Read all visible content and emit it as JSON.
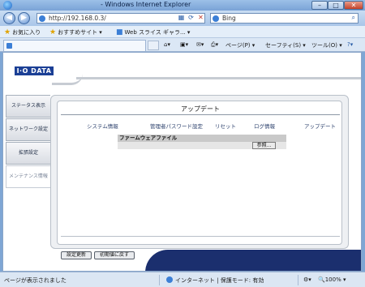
{
  "window": {
    "title": "- Windows Internet Explorer"
  },
  "nav": {
    "address": "http://192.168.0.3/",
    "search_text": "Bing"
  },
  "favorites": {
    "favorites_label": "お気に入り",
    "suggested_sites": "おすすめサイト ▾",
    "web_slice_gallery": "Web スライス ギャラ... ▾"
  },
  "command_bar": {
    "page": "ページ(P) ▾",
    "safety": "セーフティ(S) ▾",
    "tools": "ツール(O) ▾",
    "help": "?▾"
  },
  "brand": {
    "logo_text": "I·O DATA"
  },
  "sidebar": {
    "items": [
      {
        "label": "ステータス表示"
      },
      {
        "label": "ネットワーク設定"
      },
      {
        "label": "拡張設定"
      },
      {
        "label": "メンテナンス情報"
      }
    ]
  },
  "panel": {
    "title": "アップデート",
    "tabs": [
      {
        "label": "システム情報"
      },
      {
        "label": "管理者パスワード設定"
      },
      {
        "label": "リセット"
      },
      {
        "label": "ログ情報"
      },
      {
        "label": "アップデート"
      }
    ],
    "firmware_label": "ファームウェアファイル",
    "browse_button": "参照..."
  },
  "footer": {
    "apply_button": "設定更新",
    "reset_button": "初期値に戻す"
  },
  "status": {
    "text": "ページが表示されました",
    "zone": "インターネット | 保護モード: 有効",
    "zoom": "100%"
  }
}
